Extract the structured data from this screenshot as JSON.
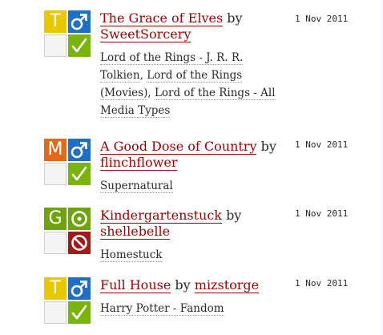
{
  "works": [
    {
      "rating": "T",
      "rating_color": "#e8c800",
      "category_icon": "male-symbol-icon",
      "completion_icon": "checkmark-icon",
      "title": "The Grace of Elves",
      "by": "by",
      "author": "SweetSorcery",
      "date": "1 Nov 2011",
      "fandoms": [
        "Lord of the Rings - J. R. R. Tolkien",
        "Lord of the Rings (Movies)",
        "Lord of the Rings - All Media Types"
      ]
    },
    {
      "rating": "M",
      "rating_color": "#e06a1c",
      "category_icon": "male-symbol-icon",
      "completion_icon": "checkmark-icon",
      "title": "A Good Dose of Country",
      "by": "by",
      "author": "flinchflower",
      "date": "1 Nov 2011",
      "fandoms": [
        "Supernatural"
      ]
    },
    {
      "rating": "G",
      "rating_color": "#6da40b",
      "category_icon": "gen-circle-icon",
      "completion_icon": "no-warnings-icon",
      "title": "Kindergartenstuck",
      "by": "by",
      "author": "shellebelle",
      "date": "1 Nov 2011",
      "fandoms": [
        "Homestuck"
      ]
    },
    {
      "rating": "T",
      "rating_color": "#e8c800",
      "category_icon": "male-symbol-icon",
      "completion_icon": "checkmark-icon",
      "title": "Full House",
      "by": "by",
      "author": "mizstorge",
      "date": "1 Nov 2011",
      "fandoms": [
        "Harry Potter - Fandom"
      ]
    }
  ]
}
